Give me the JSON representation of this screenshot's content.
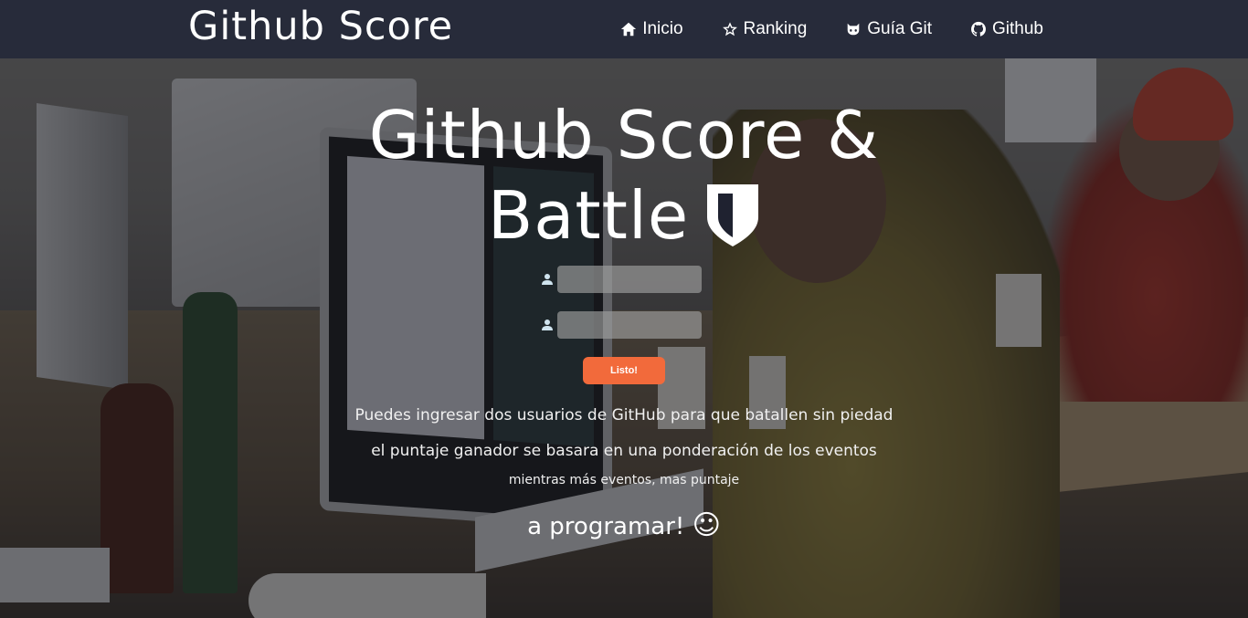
{
  "navbar": {
    "brand": "Github Score",
    "items": [
      {
        "label": "Inicio",
        "icon": "home-icon"
      },
      {
        "label": "Ranking",
        "icon": "star-icon"
      },
      {
        "label": "Guía Git",
        "icon": "octocat-icon"
      },
      {
        "label": "Github",
        "icon": "github-icon"
      }
    ]
  },
  "hero": {
    "title_line1": "Github Score &",
    "title_line2": "Battle",
    "title_icon": "shield-icon",
    "user1": {
      "placeholder": "",
      "value": "",
      "icon": "user-icon"
    },
    "user2": {
      "placeholder": "",
      "value": "",
      "icon": "user-icon"
    },
    "submit_label": "Listo!",
    "description": [
      "Puedes ingresar dos usuarios de GitHub para que batallen sin piedad",
      "el puntaje ganador se basara en una ponderación de los eventos",
      "mientras más eventos, mas puntaje"
    ],
    "cta": "a programar!",
    "cta_icon": "smile-icon"
  },
  "colors": {
    "navbar_bg": "#272b3a",
    "button_bg": "#f26a3b",
    "input_bg": "#a0a0a0"
  }
}
